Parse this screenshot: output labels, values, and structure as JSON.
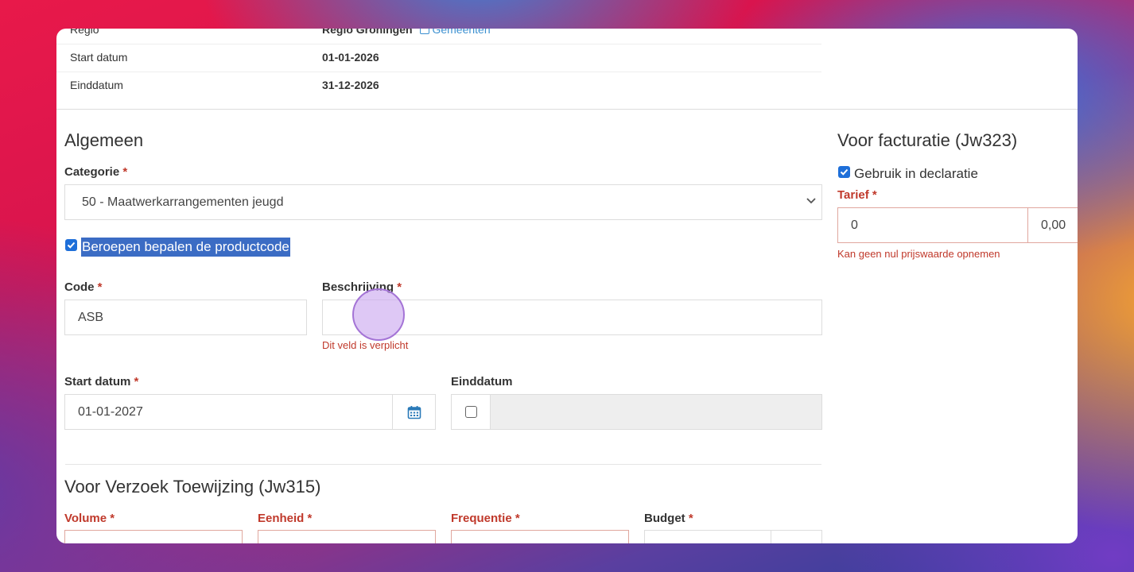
{
  "info": {
    "region_label": "Regio",
    "region_value": "Regio Groningen",
    "region_link": "Gemeenten",
    "start_label": "Start datum",
    "start_value": "01-01-2026",
    "end_label": "Einddatum",
    "end_value": "31-12-2026"
  },
  "general": {
    "title": "Algemeen",
    "category_label": "Categorie",
    "category_value": "50 - Maatwerkarrangementen jeugd",
    "professions_checkbox_label": "Beroepen bepalen de productcode",
    "professions_checked": true,
    "code_label": "Code",
    "code_value": "ASB",
    "description_label": "Beschrijving",
    "description_value": "",
    "description_error": "Dit veld is verplicht",
    "start_label": "Start datum",
    "start_value": "01-01-2027",
    "end_label": "Einddatum",
    "end_checked": false
  },
  "billing": {
    "title": "Voor facturatie (Jw323)",
    "use_in_declaration_label": "Gebruik in declaratie",
    "use_in_declaration_checked": true,
    "tariff_label": "Tarief",
    "tariff_value": "0",
    "tariff_display": "0,00",
    "tariff_error": "Kan geen nul prijswaarde opnemen"
  },
  "assignment": {
    "title": "Voor Verzoek Toewijzing (Jw315)",
    "volume_label": "Volume",
    "unit_label": "Eenheid",
    "frequency_label": "Frequentie",
    "budget_label": "Budget"
  },
  "required_mark": "*",
  "colors": {
    "accent": "#1e6fd9",
    "error": "#c0392b",
    "highlight": "#3b6cc4",
    "calendar_icon": "#2a7ab8"
  }
}
